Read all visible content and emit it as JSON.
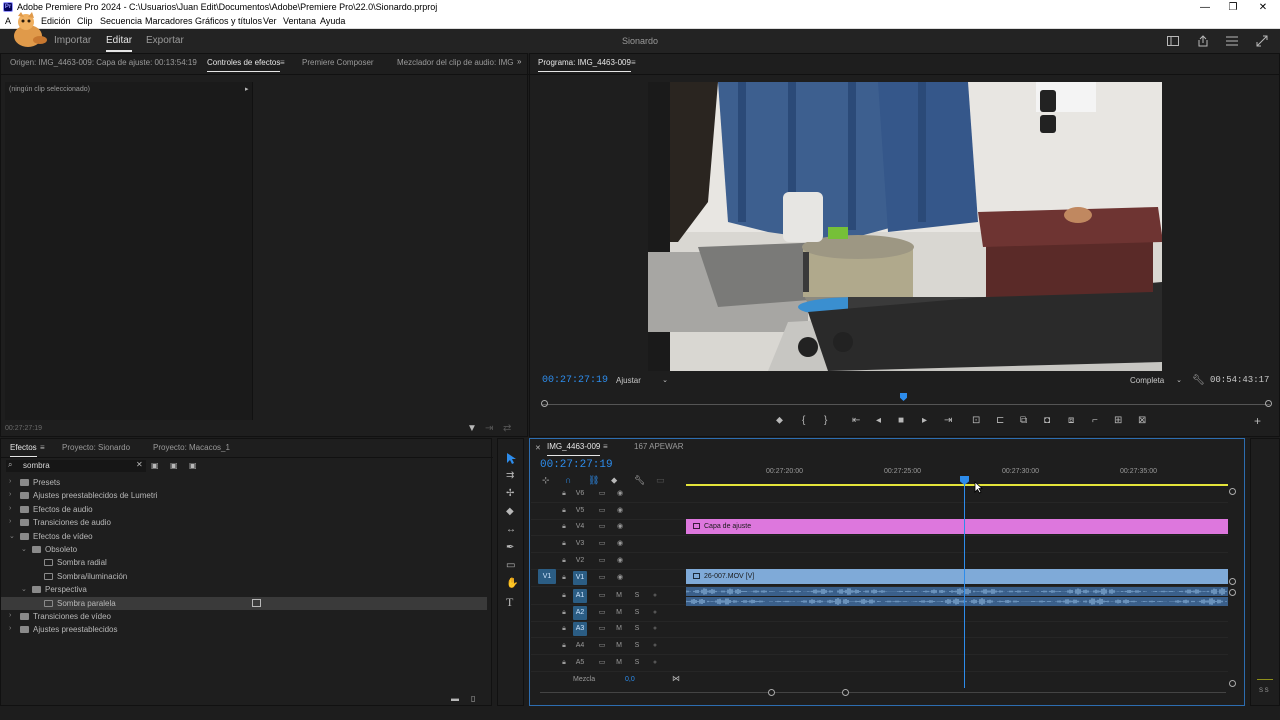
{
  "window": {
    "title": "Adobe Premiere Pro 2024 - C:\\Usuarios\\Juan Edit\\Documentos\\Adobe\\Premiere Pro\\22.0\\Sionardo.prproj",
    "logo": "Pr",
    "minimize": "—",
    "maximize": "❐",
    "close": "✕"
  },
  "menu": {
    "items": [
      "A",
      "Edición",
      "Clip",
      "Secuencia",
      "Marcadores",
      "Gráficos y títulos",
      "Ver",
      "Ventana",
      "Ayuda"
    ]
  },
  "header": {
    "tabs": [
      "Importar",
      "Editar",
      "Exportar"
    ],
    "active_tab": "Editar",
    "project_name": "Sionardo"
  },
  "source_panel": {
    "tabs": [
      "Origen: IMG_4463-009: Capa de ajuste: 00:13:54:19",
      "Controles de efectos",
      "Premiere Composer",
      "Mezclador del clip de audio: IMG"
    ],
    "no_clip": "(ningún clip seleccionado)",
    "timecode": "00:27:27:19"
  },
  "program_monitor": {
    "title": "Programa: IMG_4463-009",
    "timecode": "00:27:27:19",
    "fit": "Ajustar",
    "resolution": "Completa",
    "duration": "00:54:43:17"
  },
  "effects_panel": {
    "tabs": [
      "Efectos",
      "Proyecto: Sionardo",
      "Proyecto: Macacos_1"
    ],
    "search_value": "sombra",
    "items": [
      {
        "label": "Presets",
        "level": 0,
        "kind": "folder",
        "arrow": "›"
      },
      {
        "label": "Ajustes preestablecidos de Lumetri",
        "level": 0,
        "kind": "folder",
        "arrow": "›"
      },
      {
        "label": "Efectos de audio",
        "level": 0,
        "kind": "folder",
        "arrow": "›"
      },
      {
        "label": "Transiciones de audio",
        "level": 0,
        "kind": "folder",
        "arrow": "›"
      },
      {
        "label": "Efectos de vídeo",
        "level": 0,
        "kind": "folder",
        "arrow": "⌄"
      },
      {
        "label": "Obsoleto",
        "level": 1,
        "kind": "folder",
        "arrow": "⌄"
      },
      {
        "label": "Sombra radial",
        "level": 2,
        "kind": "effect",
        "arrow": ""
      },
      {
        "label": "Sombra/iluminación",
        "level": 2,
        "kind": "effect",
        "arrow": ""
      },
      {
        "label": "Perspectiva",
        "level": 1,
        "kind": "folder",
        "arrow": "⌄"
      },
      {
        "label": "Sombra paralela",
        "level": 2,
        "kind": "effect",
        "arrow": "",
        "selected": true
      },
      {
        "label": "Transiciones de vídeo",
        "level": 0,
        "kind": "folder",
        "arrow": "›"
      },
      {
        "label": "Ajustes preestablecidos",
        "level": 0,
        "kind": "folder",
        "arrow": "›"
      }
    ]
  },
  "timeline": {
    "tabs": [
      "IMG_4463-009",
      "167 APEWAR"
    ],
    "timecode": "00:27:27:19",
    "ruler": [
      "00:27:20:00",
      "00:27:25:00",
      "00:27:30:00",
      "00:27:35:00"
    ],
    "video_tracks": [
      "V6",
      "V5",
      "V4",
      "V3",
      "V2",
      "V1"
    ],
    "audio_tracks": [
      "A1",
      "A2",
      "A3",
      "A4",
      "A5"
    ],
    "v1_source": "V1",
    "clips": {
      "adjustment": "Capa de ajuste",
      "video": "26-007.MOV [V]"
    },
    "mix_label": "Mezcla",
    "mix_value": "0,0",
    "mute": "M",
    "solo": "S",
    "meter_labels": "S S"
  },
  "colors": {
    "accent": "#2d8ceb",
    "adjustment_clip": "#dd77dd",
    "video_clip": "#7faad8",
    "audio_clip": "#6a9ac8",
    "work_area": "#e3e33a"
  }
}
